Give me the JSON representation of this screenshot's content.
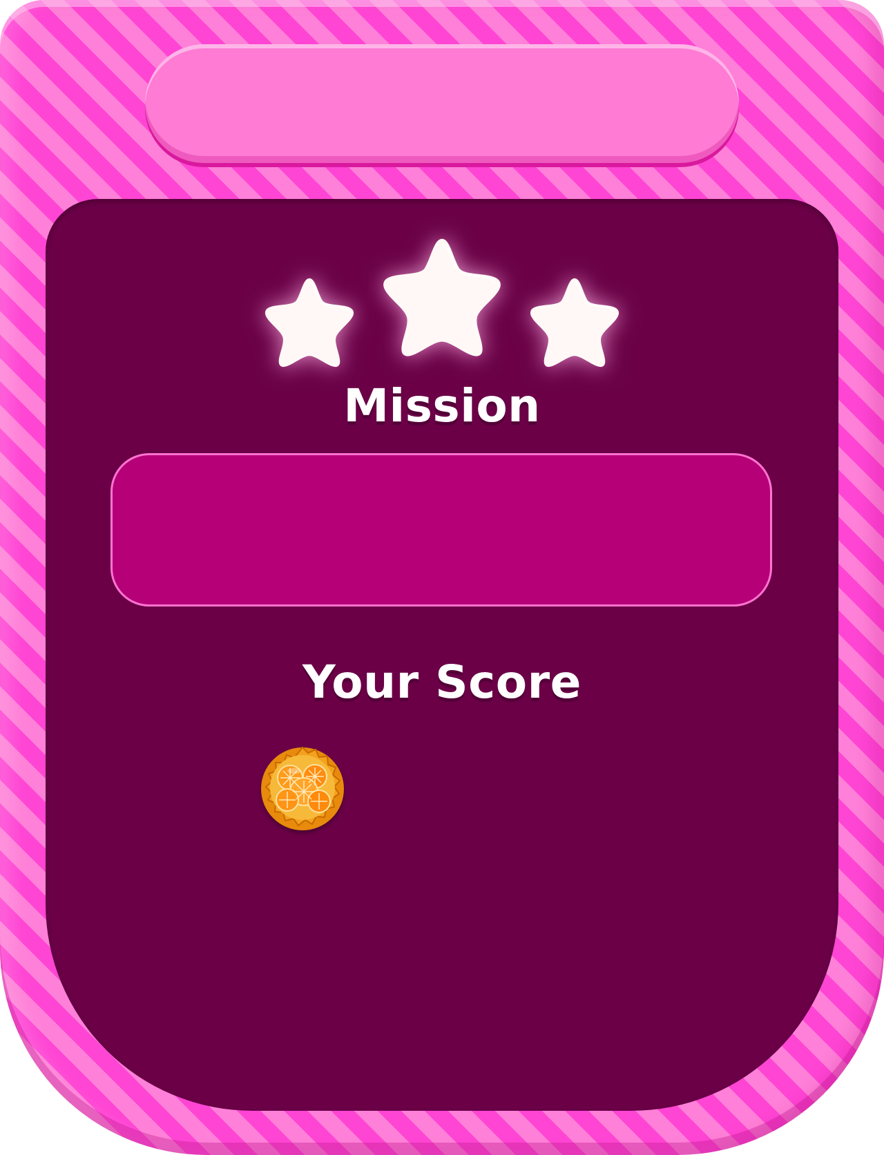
{
  "header": {
    "title": ""
  },
  "stars": {
    "earned": 3,
    "total": 3,
    "icon": "star-icon"
  },
  "mission": {
    "heading": "Mission",
    "description": ""
  },
  "score": {
    "heading": "Your Score",
    "icon": "orange-tart-icon",
    "value": ""
  },
  "colors": {
    "frame_pink": "#ff45d4",
    "frame_stripe_light": "#ff80d8",
    "title_pill": "#ff7bd4",
    "panel": "#6b0047",
    "mission_box": "#b50077",
    "mission_box_border": "#ff73d0",
    "text": "#ffffff",
    "star": "#fff8f6"
  }
}
